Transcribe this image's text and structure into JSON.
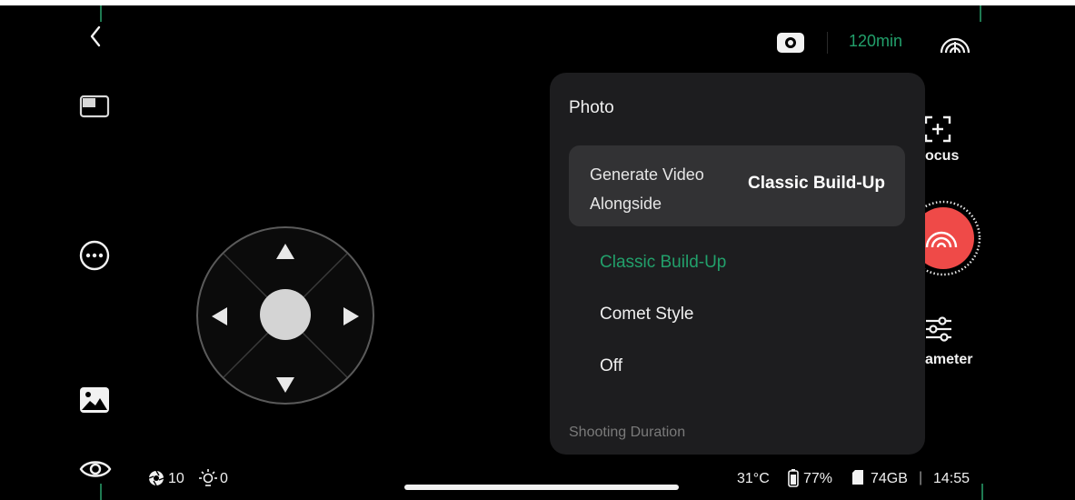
{
  "top_bar": {
    "remaining_time": "120min",
    "colors": {
      "accent": "#22a06b",
      "shutter": "#ef4a48"
    }
  },
  "left_bar": {
    "icons": [
      "back-icon",
      "layout-icon",
      "more-icon",
      "gallery-icon",
      "eye-icon"
    ]
  },
  "joystick": {
    "icons": [
      "arrow-up-icon",
      "arrow-down-icon",
      "arrow-left-icon",
      "arrow-right-icon",
      "joystick-knob"
    ]
  },
  "right_bar": {
    "focus_label": "ocus",
    "parameter_label": "ameter"
  },
  "panel": {
    "title": "Photo",
    "setting": {
      "label_line1": "Generate Video",
      "label_line2": "Alongside",
      "value": "Classic Build-Up"
    },
    "options": [
      {
        "label": "Classic Build-Up",
        "selected": true
      },
      {
        "label": "Comet Style",
        "selected": false
      },
      {
        "label": "Off",
        "selected": false
      }
    ],
    "next_section": "Shooting Duration"
  },
  "bottom_status": {
    "aperture_value": "10",
    "light_value": "0",
    "temperature": "31°C",
    "battery": "77%",
    "storage": "74GB",
    "separator": "|",
    "time": "14:55"
  }
}
